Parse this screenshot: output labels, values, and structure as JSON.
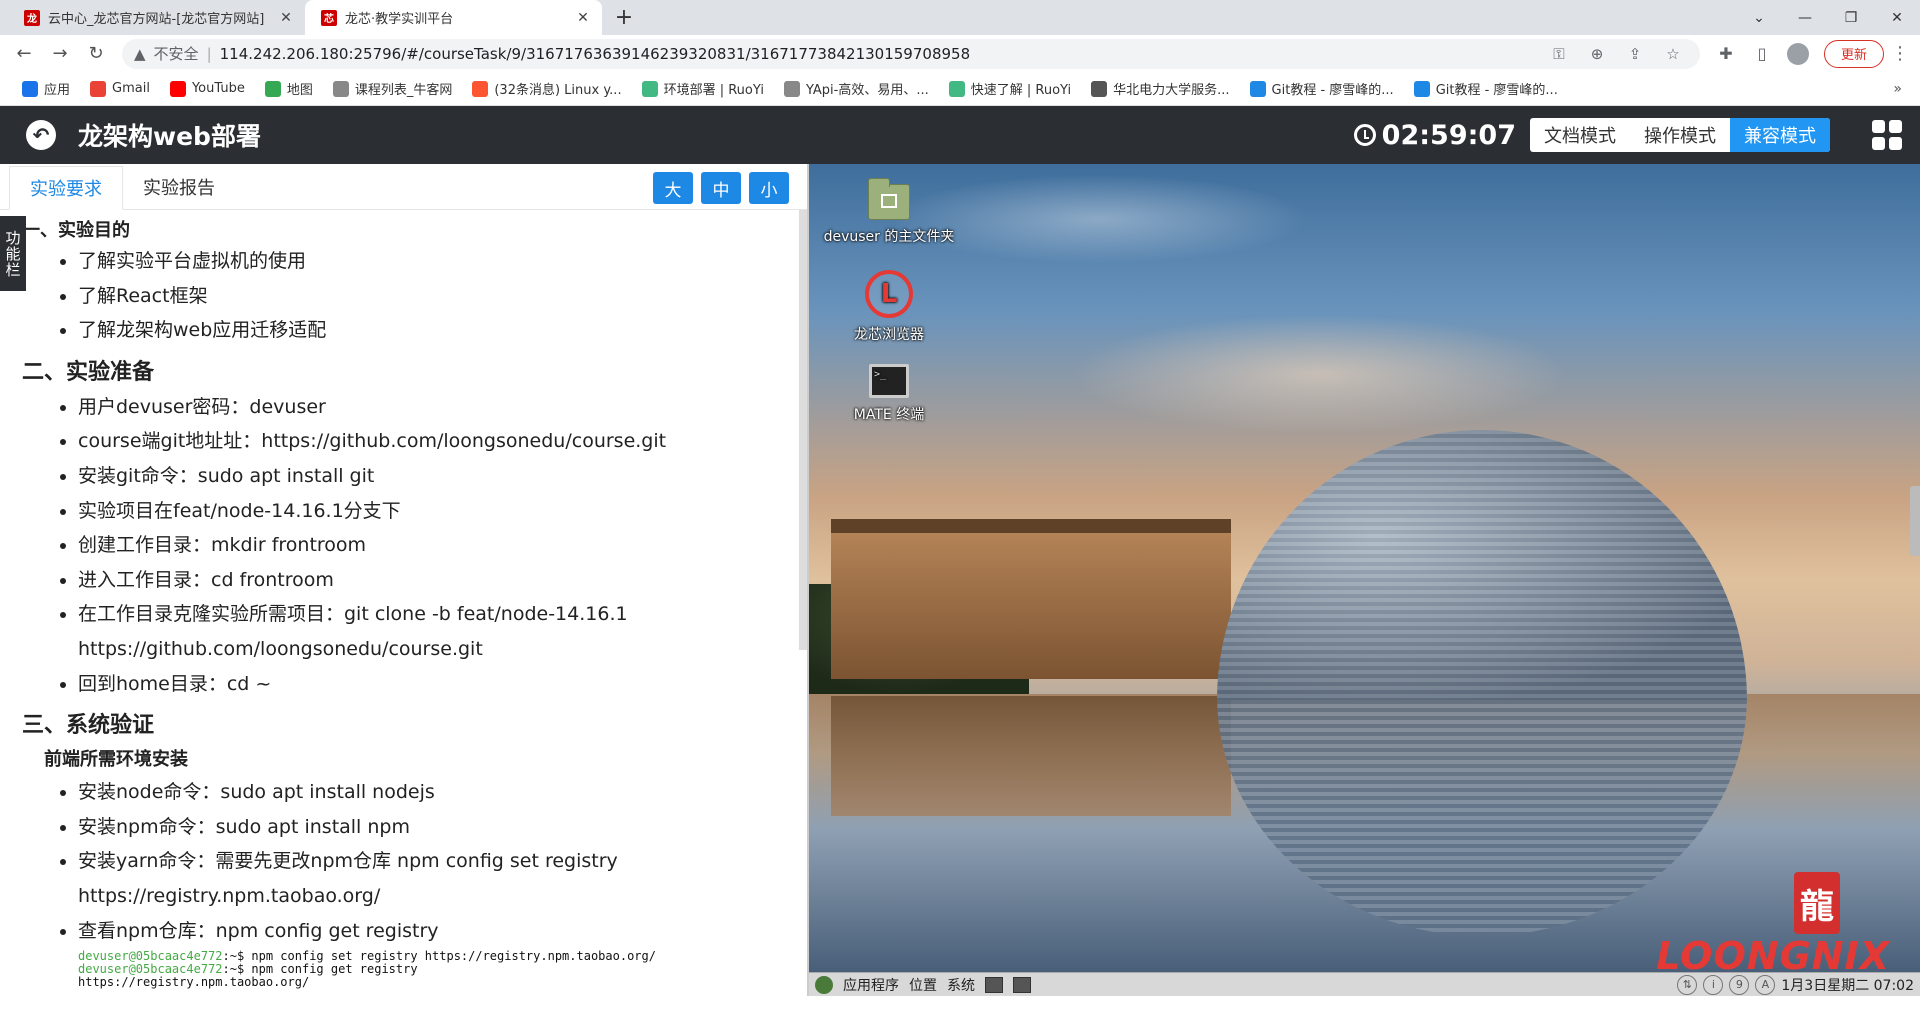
{
  "browser": {
    "tabs": [
      {
        "title": "云中心_龙芯官方网站-[龙芯官方网站]",
        "favicon": "loongson-logo-icon",
        "active": false
      },
      {
        "title": "龙芯·教学实训平台",
        "favicon": "loongson-edu-icon",
        "active": true
      }
    ],
    "new_tab": "+",
    "address": {
      "security": "不安全",
      "url": "114.242.206.180:25796/#/courseTask/9/3167176363914623932083​1/3167177384213015970895​8"
    },
    "update_label": "更新",
    "bookmarks": [
      {
        "label": "应用",
        "icon": "apps-grid-icon",
        "color": "#1a73e8"
      },
      {
        "label": "Gmail",
        "icon": "gmail-icon",
        "color": "#ea4335"
      },
      {
        "label": "YouTube",
        "icon": "youtube-icon",
        "color": "#ff0000"
      },
      {
        "label": "地图",
        "icon": "maps-icon",
        "color": "#34a853"
      },
      {
        "label": "课程列表_牛客网",
        "icon": "nowcoder-icon",
        "color": "#888888"
      },
      {
        "label": "(32条消息) Linux y...",
        "icon": "csdn-icon",
        "color": "#fc5531"
      },
      {
        "label": "环境部署 | RuoYi",
        "icon": "ruoyi-icon",
        "color": "#42b983"
      },
      {
        "label": "YApi-高效、易用、...",
        "icon": "yapi-icon",
        "color": "#888888"
      },
      {
        "label": "快速了解 | RuoYi",
        "icon": "ruoyi-icon",
        "color": "#42b983"
      },
      {
        "label": "华北电力大学服务...",
        "icon": "globe-icon",
        "color": "#555555"
      },
      {
        "label": "Git教程 - 廖雪峰的...",
        "icon": "rocket-icon",
        "color": "#1e88e5"
      },
      {
        "label": "Git教程 - 廖雪峰的...",
        "icon": "rocket-icon",
        "color": "#1e88e5"
      }
    ],
    "more": "»"
  },
  "app": {
    "title": "龙架构web部署",
    "timer": "02:59:07",
    "modes": [
      {
        "label": "文档模式",
        "active": false
      },
      {
        "label": "操作模式",
        "active": false
      },
      {
        "label": "兼容模式",
        "active": true
      }
    ]
  },
  "left": {
    "tabs": [
      {
        "label": "实验要求",
        "active": true
      },
      {
        "label": "实验报告",
        "active": false
      }
    ],
    "size_buttons": [
      "大",
      "中",
      "小"
    ],
    "function_bar": "功能栏",
    "sections": [
      {
        "heading": "一、实验目的",
        "items": [
          "了解实验平台虚拟机的使用",
          "了解React框架",
          "了解龙架构web应用迁移适配"
        ]
      },
      {
        "heading": "二、实验准备",
        "items": [
          "用户devuser密码：devuser",
          "course端git地址址：https://github.com/loongsonedu/course.git",
          "安装git命令：sudo apt install git",
          "实验项目在feat/node-14.16.1分支下",
          "创建工作目录：mkdir frontroom",
          "进入工作目录：cd frontroom",
          "在工作目录克隆实验所需项目：git clone -b feat/node-14.16.1 https://github.com/loongsonedu/course.git",
          "回到home目录：cd ~"
        ]
      },
      {
        "heading": "三、系统验证",
        "subheading": "前端所需环境安装",
        "items": [
          "安装node命令：sudo apt install nodejs",
          "安装npm命令：sudo apt install npm",
          "安装yarn命令：需要先更改npm仓库 npm config set registry https://registry.npm.taobao.org/",
          "查看npm仓库：npm config get registry"
        ]
      }
    ],
    "terminal": [
      {
        "prompt": "devuser@05bcaac4e772",
        "cmd": ":~$ npm config set registry https://registry.npm.taobao.org/"
      },
      {
        "prompt": "devuser@05bcaac4e772",
        "cmd": ":~$ npm config get registry"
      },
      {
        "prompt": "",
        "cmd": "https://registry.npm.taobao.org/"
      }
    ]
  },
  "desktop": {
    "icons": [
      {
        "label": "devuser 的主文件夹"
      },
      {
        "label": "龙芯浏览器"
      },
      {
        "label": "MATE 终端"
      }
    ],
    "brand": "LOONGNIX",
    "panel": {
      "menus": [
        "应用程序",
        "位置",
        "系统"
      ],
      "clock": "1月3日星期二 07:02"
    }
  }
}
